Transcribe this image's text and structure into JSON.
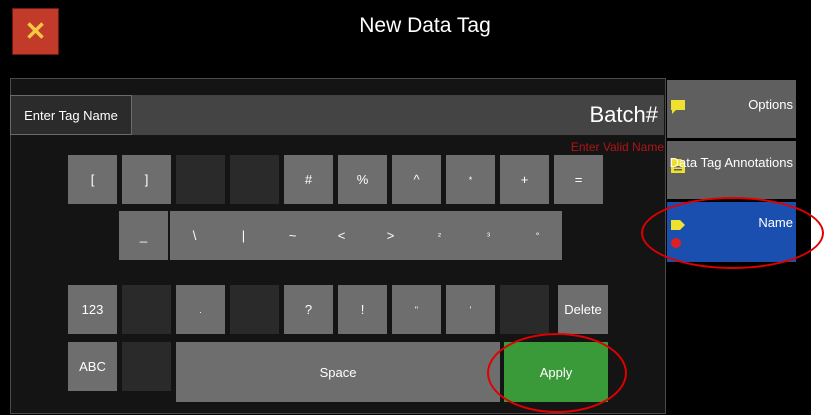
{
  "header": {
    "title": "New Data Tag",
    "close_label": "✕"
  },
  "tag_name": {
    "label": "Enter Tag Name",
    "value": "Batch#",
    "validation": "Enter Valid Name"
  },
  "keyboard": {
    "row1": [
      "[",
      "]",
      "",
      "",
      "#",
      "%",
      "^",
      "*",
      "+",
      "="
    ],
    "row2": [
      "_",
      "\\",
      "|",
      "~",
      "<",
      ">",
      "²",
      "³",
      "°"
    ],
    "row3": [
      "123",
      "",
      ".",
      "",
      "?",
      "!",
      "\"",
      "'",
      "",
      "Delete"
    ],
    "row4": [
      "ABC",
      "",
      "Space",
      "Apply"
    ]
  },
  "sidebar": {
    "items": [
      {
        "label": "Options",
        "icon": "comment-icon"
      },
      {
        "label": "Data Tag Annotations",
        "icon": "document-icon"
      },
      {
        "label": "Name",
        "icon": "tag-icon",
        "active": true,
        "alert": true
      }
    ]
  },
  "colors": {
    "background": "#000000",
    "close": "#c23a2a",
    "apply": "#3a9a3a",
    "active_tab": "#1a4fb0",
    "validation": "#b01515",
    "highlight": "#e00000"
  }
}
